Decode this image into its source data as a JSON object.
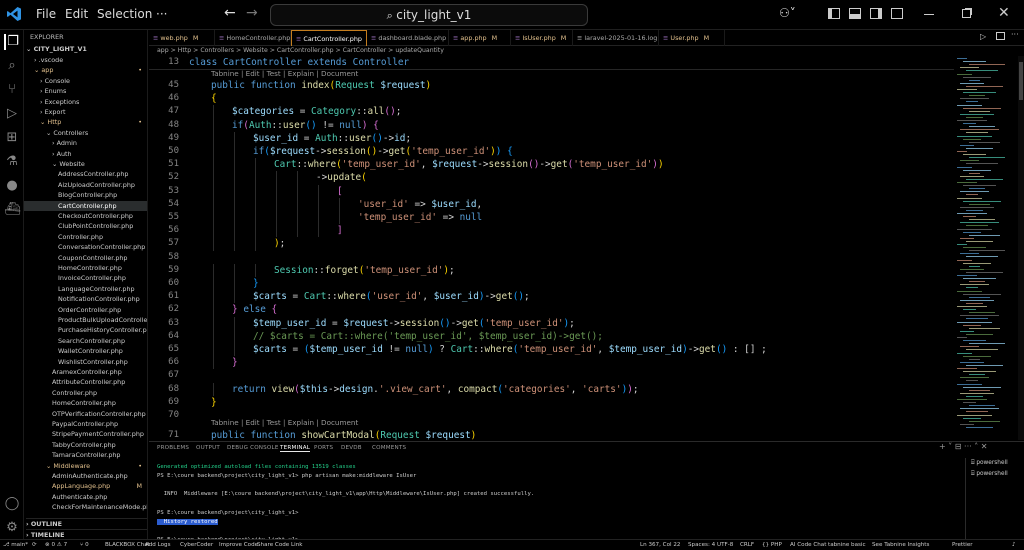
{
  "titlebar": {
    "menu": [
      "File",
      "Edit",
      "Selection"
    ],
    "more": "···",
    "search": "city_light_v1"
  },
  "explorer": {
    "title": "EXPLORER",
    "root": "CITY_LIGHT_V1",
    "items": [
      {
        "t": "› .vscode",
        "d": 1
      },
      {
        "t": "⌄ app",
        "d": 1,
        "g": true
      },
      {
        "t": "› Console",
        "d": 2
      },
      {
        "t": "› Enums",
        "d": 2
      },
      {
        "t": "› Exceptions",
        "d": 2
      },
      {
        "t": "› Export",
        "d": 2
      },
      {
        "t": "⌄ Http",
        "d": 2,
        "g": true
      },
      {
        "t": "⌄ Controllers",
        "d": 3
      },
      {
        "t": "› Admin",
        "d": 4
      },
      {
        "t": "› Auth",
        "d": 4
      },
      {
        "t": "⌄ Website",
        "d": 4
      },
      {
        "t": "AddressController.php",
        "d": 5
      },
      {
        "t": "AizUploadController.php",
        "d": 5
      },
      {
        "t": "BlogController.php",
        "d": 5
      },
      {
        "t": "CartController.php",
        "d": 5,
        "sel": true
      },
      {
        "t": "CheckoutController.php",
        "d": 5
      },
      {
        "t": "ClubPointController.php",
        "d": 5
      },
      {
        "t": "Controller.php",
        "d": 5
      },
      {
        "t": "ConversationController.php",
        "d": 5
      },
      {
        "t": "CouponController.php",
        "d": 5
      },
      {
        "t": "HomeController.php",
        "d": 5
      },
      {
        "t": "InvoiceController.php",
        "d": 5
      },
      {
        "t": "LanguageController.php",
        "d": 5
      },
      {
        "t": "NotificationController.php",
        "d": 5
      },
      {
        "t": "OrderController.php",
        "d": 5
      },
      {
        "t": "ProductBulkUploadController.p...",
        "d": 5
      },
      {
        "t": "PurchaseHistoryController.php",
        "d": 5
      },
      {
        "t": "SearchController.php",
        "d": 5
      },
      {
        "t": "WalletController.php",
        "d": 5
      },
      {
        "t": "WishlistController.php",
        "d": 5
      },
      {
        "t": "AramexController.php",
        "d": 4
      },
      {
        "t": "AttributeController.php",
        "d": 4
      },
      {
        "t": "Controller.php",
        "d": 4
      },
      {
        "t": "HomeController.php",
        "d": 4
      },
      {
        "t": "OTPVerificationController.php",
        "d": 4
      },
      {
        "t": "PaypalController.php",
        "d": 4
      },
      {
        "t": "StripePaymentController.php",
        "d": 4
      },
      {
        "t": "TabbyController.php",
        "d": 4
      },
      {
        "t": "TamaraController.php",
        "d": 4
      },
      {
        "t": "⌄ Middleware",
        "d": 3,
        "g": true
      },
      {
        "t": "AdminAuthenticate.php",
        "d": 4
      },
      {
        "t": "AppLanguage.php",
        "d": 4,
        "m": true
      },
      {
        "t": "Authenticate.php",
        "d": 4
      },
      {
        "t": "CheckForMaintenanceMode.php",
        "d": 4
      }
    ],
    "outline": "OUTLINE",
    "timeline": "TIMELINE"
  },
  "tabs": [
    {
      "name": "web.php",
      "m": "M"
    },
    {
      "name": "HomeController.php",
      "m": ""
    },
    {
      "name": "CartController.php",
      "m": "×",
      "active": true
    },
    {
      "name": "dashboard.blade.php",
      "m": ""
    },
    {
      "name": "app.php",
      "m": "M"
    },
    {
      "name": "IsUser.php",
      "m": "M"
    },
    {
      "name": "laravel-2025-01-16.log",
      "m": ""
    },
    {
      "name": "User.php",
      "m": "M"
    }
  ],
  "breadcrumb": "app > Http > Controllers > Website > CartController.php > CartController > updateQuantity",
  "sticky": {
    "ln": "13",
    "code": "class CartController extends Controller"
  },
  "tabnine1": "Tabnine | Edit | Test | Explain | Document",
  "tabnine2": "Tabnine | Edit | Test | Explain | Document",
  "code": [
    {
      "ln": "45",
      "x": 0,
      "t": [
        [
          "kw",
          "public function "
        ],
        [
          "fn",
          "index"
        ],
        [
          "br1",
          "("
        ],
        [
          "cls",
          "Request "
        ],
        [
          "var",
          "$request"
        ],
        [
          "br1",
          ")"
        ]
      ]
    },
    {
      "ln": "46",
      "x": 0,
      "t": [
        [
          "br1",
          "{"
        ]
      ]
    },
    {
      "ln": "47",
      "x": 1,
      "t": [
        [
          "var",
          "$categories"
        ],
        [
          "op",
          " = "
        ],
        [
          "cls",
          "Category"
        ],
        [
          "op",
          "::"
        ],
        [
          "fn",
          "all"
        ],
        [
          "br2",
          "()"
        ],
        [
          "op",
          ";"
        ]
      ]
    },
    {
      "ln": "48",
      "x": 1,
      "t": [
        [
          "kw",
          "if"
        ],
        [
          "br2",
          "("
        ],
        [
          "cls",
          "Auth"
        ],
        [
          "op",
          "::"
        ],
        [
          "fn",
          "user"
        ],
        [
          "br3",
          "()"
        ],
        [
          "op",
          " != "
        ],
        [
          "kw",
          "null"
        ],
        [
          "br2",
          ")"
        ],
        [
          "op",
          " "
        ],
        [
          "br2",
          "{"
        ]
      ]
    },
    {
      "ln": "49",
      "x": 2,
      "t": [
        [
          "var",
          "$user_id"
        ],
        [
          "op",
          " = "
        ],
        [
          "cls",
          "Auth"
        ],
        [
          "op",
          "::"
        ],
        [
          "fn",
          "user"
        ],
        [
          "br3",
          "()"
        ],
        [
          "op",
          "->"
        ],
        [
          "var",
          "id"
        ],
        [
          "op",
          ";"
        ]
      ]
    },
    {
      "ln": "50",
      "x": 2,
      "t": [
        [
          "kw",
          "if"
        ],
        [
          "br3",
          "("
        ],
        [
          "var",
          "$request"
        ],
        [
          "op",
          "->"
        ],
        [
          "fn",
          "session"
        ],
        [
          "br1",
          "()"
        ],
        [
          "op",
          "->"
        ],
        [
          "fn",
          "get"
        ],
        [
          "br1",
          "("
        ],
        [
          "str",
          "'temp_user_id'"
        ],
        [
          "br1",
          ")"
        ],
        [
          "br3",
          ")"
        ],
        [
          "op",
          " "
        ],
        [
          "br3",
          "{"
        ]
      ]
    },
    {
      "ln": "51",
      "x": 3,
      "t": [
        [
          "cls",
          "Cart"
        ],
        [
          "op",
          "::"
        ],
        [
          "fn",
          "where"
        ],
        [
          "br1",
          "("
        ],
        [
          "str",
          "'temp_user_id'"
        ],
        [
          "op",
          ", "
        ],
        [
          "var",
          "$request"
        ],
        [
          "op",
          "->"
        ],
        [
          "fn",
          "session"
        ],
        [
          "br2",
          "()"
        ],
        [
          "op",
          "->"
        ],
        [
          "fn",
          "get"
        ],
        [
          "br2",
          "("
        ],
        [
          "str",
          "'temp_user_id'"
        ],
        [
          "br2",
          ")"
        ],
        [
          "br1",
          ")"
        ]
      ]
    },
    {
      "ln": "52",
      "x": 5,
      "t": [
        [
          "op",
          "->"
        ],
        [
          "fn",
          "update"
        ],
        [
          "br1",
          "("
        ]
      ]
    },
    {
      "ln": "53",
      "x": 6,
      "t": [
        [
          "br2",
          "["
        ]
      ]
    },
    {
      "ln": "54",
      "x": 7,
      "t": [
        [
          "str",
          "'user_id'"
        ],
        [
          "op",
          " => "
        ],
        [
          "var",
          "$user_id"
        ],
        [
          "op",
          ","
        ]
      ]
    },
    {
      "ln": "55",
      "x": 7,
      "t": [
        [
          "str",
          "'temp_user_id'"
        ],
        [
          "op",
          " => "
        ],
        [
          "kw",
          "null"
        ]
      ]
    },
    {
      "ln": "56",
      "x": 6,
      "t": [
        [
          "br2",
          "]"
        ]
      ]
    },
    {
      "ln": "57",
      "x": 3,
      "t": [
        [
          "br1",
          ")"
        ],
        [
          "op",
          ";"
        ]
      ]
    },
    {
      "ln": "58",
      "x": 0,
      "t": []
    },
    {
      "ln": "59",
      "x": 3,
      "t": [
        [
          "cls",
          "Session"
        ],
        [
          "op",
          "::"
        ],
        [
          "fn",
          "forget"
        ],
        [
          "br1",
          "("
        ],
        [
          "str",
          "'temp_user_id'"
        ],
        [
          "br1",
          ")"
        ],
        [
          "op",
          ";"
        ]
      ]
    },
    {
      "ln": "60",
      "x": 2,
      "t": [
        [
          "br3",
          "}"
        ]
      ]
    },
    {
      "ln": "61",
      "x": 2,
      "t": [
        [
          "var",
          "$carts"
        ],
        [
          "op",
          " = "
        ],
        [
          "cls",
          "Cart"
        ],
        [
          "op",
          "::"
        ],
        [
          "fn",
          "where"
        ],
        [
          "br3",
          "("
        ],
        [
          "str",
          "'user_id'"
        ],
        [
          "op",
          ", "
        ],
        [
          "var",
          "$user_id"
        ],
        [
          "br3",
          ")"
        ],
        [
          "op",
          "->"
        ],
        [
          "fn",
          "get"
        ],
        [
          "br3",
          "()"
        ],
        [
          "op",
          ";"
        ]
      ]
    },
    {
      "ln": "62",
      "x": 1,
      "t": [
        [
          "br2",
          "}"
        ],
        [
          "op",
          " "
        ],
        [
          "kw",
          "else"
        ],
        [
          "op",
          " "
        ],
        [
          "br2",
          "{"
        ]
      ]
    },
    {
      "ln": "63",
      "x": 2,
      "t": [
        [
          "var",
          "$temp_user_id"
        ],
        [
          "op",
          " = "
        ],
        [
          "var",
          "$request"
        ],
        [
          "op",
          "->"
        ],
        [
          "fn",
          "session"
        ],
        [
          "br3",
          "()"
        ],
        [
          "op",
          "->"
        ],
        [
          "fn",
          "get"
        ],
        [
          "br3",
          "("
        ],
        [
          "str",
          "'temp_user_id'"
        ],
        [
          "br3",
          ")"
        ],
        [
          "op",
          ";"
        ]
      ]
    },
    {
      "ln": "64",
      "x": 2,
      "t": [
        [
          "cm",
          "// $carts = Cart::where('temp_user_id', $temp_user_id)->get();"
        ]
      ]
    },
    {
      "ln": "65",
      "x": 2,
      "t": [
        [
          "var",
          "$carts"
        ],
        [
          "op",
          " = "
        ],
        [
          "br3",
          "("
        ],
        [
          "var",
          "$temp_user_id"
        ],
        [
          "op",
          " != "
        ],
        [
          "kw",
          "null"
        ],
        [
          "br3",
          ")"
        ],
        [
          "op",
          " ? "
        ],
        [
          "cls",
          "Cart"
        ],
        [
          "op",
          "::"
        ],
        [
          "fn",
          "where"
        ],
        [
          "br3",
          "("
        ],
        [
          "str",
          "'temp_user_id'"
        ],
        [
          "op",
          ", "
        ],
        [
          "var",
          "$temp_user_id"
        ],
        [
          "br3",
          ")"
        ],
        [
          "op",
          "->"
        ],
        [
          "fn",
          "get"
        ],
        [
          "br3",
          "()"
        ],
        [
          "op",
          " : [] ;"
        ]
      ]
    },
    {
      "ln": "66",
      "x": 1,
      "t": [
        [
          "br2",
          "}"
        ]
      ]
    },
    {
      "ln": "67",
      "x": 0,
      "t": []
    },
    {
      "ln": "68",
      "x": 1,
      "t": [
        [
          "kw",
          "return "
        ],
        [
          "fn",
          "view"
        ],
        [
          "br2",
          "("
        ],
        [
          "var",
          "$this"
        ],
        [
          "op",
          "->"
        ],
        [
          "var",
          "design"
        ],
        [
          "op",
          "."
        ],
        [
          "str",
          "'.view_cart'"
        ],
        [
          "op",
          ", "
        ],
        [
          "fn",
          "compact"
        ],
        [
          "br3",
          "("
        ],
        [
          "str",
          "'categories'"
        ],
        [
          "op",
          ", "
        ],
        [
          "str",
          "'carts'"
        ],
        [
          "br3",
          ")"
        ],
        [
          "br2",
          ")"
        ],
        [
          "op",
          ";"
        ]
      ]
    },
    {
      "ln": "69",
      "x": 0,
      "t": [
        [
          "br1",
          "}"
        ]
      ]
    },
    {
      "ln": "70",
      "x": 0,
      "t": []
    }
  ],
  "line71": {
    "ln": "71",
    "t": [
      [
        "kw",
        "public function "
      ],
      [
        "fn",
        "showCartModal"
      ],
      [
        "br1",
        "("
      ],
      [
        "cls",
        "Request "
      ],
      [
        "var",
        "$request"
      ],
      [
        "br1",
        ")"
      ]
    ]
  },
  "panel": {
    "tabs": [
      "PROBLEMS",
      "OUTPUT",
      "DEBUG CONSOLE",
      "TERMINAL",
      "PORTS",
      "DEVDB",
      "COMMENTS"
    ],
    "lines": [
      "Generated optimized autoload files containing 13519 classes",
      "PS E:\\coure backend\\project\\city_light_v1> php artisan make:middleware IsUser",
      "",
      "  INFO  Middleware [E:\\coure backend\\project\\city_light_v1\\app\\Http\\Middleware\\IsUser.php] created successfully.",
      "",
      "PS E:\\coure backend\\project\\city_light_v1>",
      "  History restored",
      "",
      "PS E:\\coure backend\\project\\city_light_v1> "
    ],
    "terminals": [
      "powershell",
      "powershell"
    ]
  },
  "status": {
    "left": [
      "⎇ main*",
      "⟳",
      "⊗ 0 ⚠ 7",
      "⑂ 0",
      "BLACKBOX Chat",
      "Add Logs",
      "CyberCoder",
      "Improve Code",
      "Share Code Link"
    ],
    "right": [
      "Ln 367, Col 22",
      "Spaces: 4",
      "UTF-8",
      "CRLF",
      "{} PHP",
      "AI Code Chat",
      "tabnine basic",
      "See Tabnine Insights",
      "Prettier"
    ]
  },
  "colors": {
    "accent": "#c47d1e",
    "modified": "#e2c08d"
  }
}
